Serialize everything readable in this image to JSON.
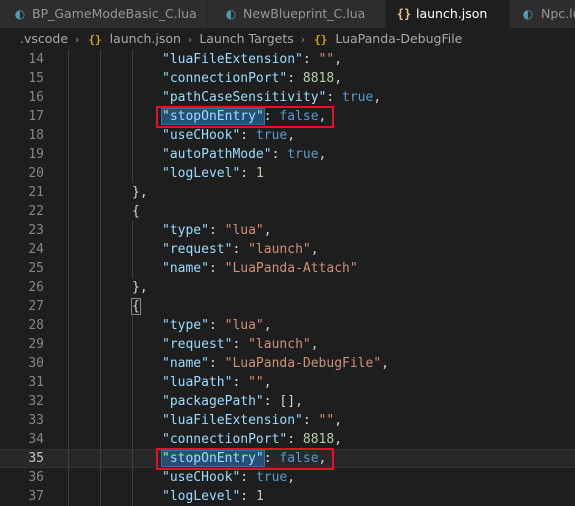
{
  "tabs": [
    {
      "label": "BP_GameModeBasic_C.lua",
      "icon": "lua-moon-icon",
      "active": false
    },
    {
      "label": "NewBlueprint_C.lua",
      "icon": "lua-moon-icon",
      "active": false
    },
    {
      "label": "launch.json",
      "icon": "json-braces-icon",
      "active": true
    },
    {
      "label": "Npc.lu",
      "icon": "lua-moon-icon",
      "active": false
    }
  ],
  "breadcrumb": {
    "folder": ".vscode",
    "file": "launch.json",
    "node1": "Launch Targets",
    "node2": "LuaPanda-DebugFile"
  },
  "editor": {
    "current_line": 35,
    "highlight_boxes": [
      17,
      35
    ],
    "lines": [
      {
        "n": "14",
        "code": "\"luaFileExtension\": \"\","
      },
      {
        "n": "15",
        "code": "\"connectionPort\": 8818,"
      },
      {
        "n": "16",
        "code": "\"pathCaseSensitivity\": true,"
      },
      {
        "n": "17",
        "code": "\"stopOnEntry\": false,"
      },
      {
        "n": "18",
        "code": "\"useCHook\": true,"
      },
      {
        "n": "19",
        "code": "\"autoPathMode\": true,"
      },
      {
        "n": "20",
        "code": "\"logLevel\": 1"
      },
      {
        "n": "21",
        "code": "},"
      },
      {
        "n": "22",
        "code": "{"
      },
      {
        "n": "23",
        "code": "\"type\": \"lua\","
      },
      {
        "n": "24",
        "code": "\"request\": \"launch\","
      },
      {
        "n": "25",
        "code": "\"name\": \"LuaPanda-Attach\""
      },
      {
        "n": "26",
        "code": "},"
      },
      {
        "n": "27",
        "code": "{"
      },
      {
        "n": "28",
        "code": "\"type\": \"lua\","
      },
      {
        "n": "29",
        "code": "\"request\": \"launch\","
      },
      {
        "n": "30",
        "code": "\"name\": \"LuaPanda-DebugFile\","
      },
      {
        "n": "31",
        "code": "\"luaPath\": \"\","
      },
      {
        "n": "32",
        "code": "\"packagePath\": [],"
      },
      {
        "n": "33",
        "code": "\"luaFileExtension\": \"\","
      },
      {
        "n": "34",
        "code": "\"connectionPort\": 8818,"
      },
      {
        "n": "35",
        "code": "\"stopOnEntry\": false,"
      },
      {
        "n": "36",
        "code": "\"useCHook\": true,"
      },
      {
        "n": "37",
        "code": "\"logLevel\": 1"
      }
    ]
  }
}
